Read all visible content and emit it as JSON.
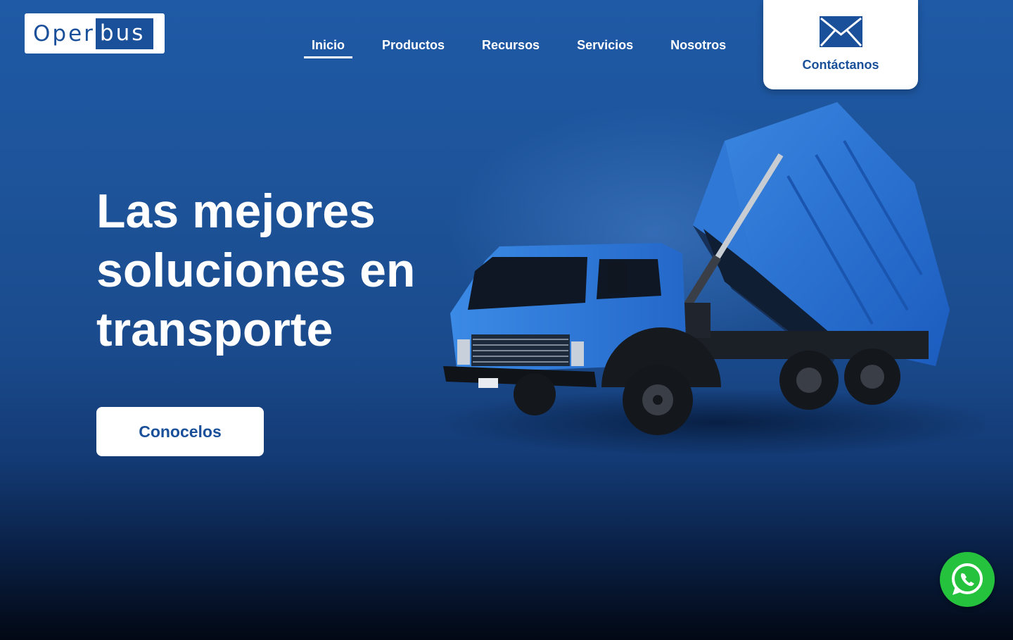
{
  "brand": {
    "logo_part1": "Oper",
    "logo_part2": "bus",
    "color": "#1a4f9a"
  },
  "nav": {
    "items": [
      {
        "label": "Inicio",
        "active": true
      },
      {
        "label": "Productos",
        "active": false
      },
      {
        "label": "Recursos",
        "active": false
      },
      {
        "label": "Servicios",
        "active": false
      },
      {
        "label": "Nosotros",
        "active": false
      }
    ]
  },
  "contact": {
    "label": "Contáctanos",
    "icon": "mail-icon"
  },
  "hero": {
    "title_line1": "Las mejores",
    "title_line2": "soluciones en",
    "title_line3": "transporte",
    "cta_label": "Conocelos",
    "image": "blue-dump-truck"
  },
  "floating": {
    "whatsapp_icon": "whatsapp-icon",
    "whatsapp_color": "#25c23d"
  }
}
